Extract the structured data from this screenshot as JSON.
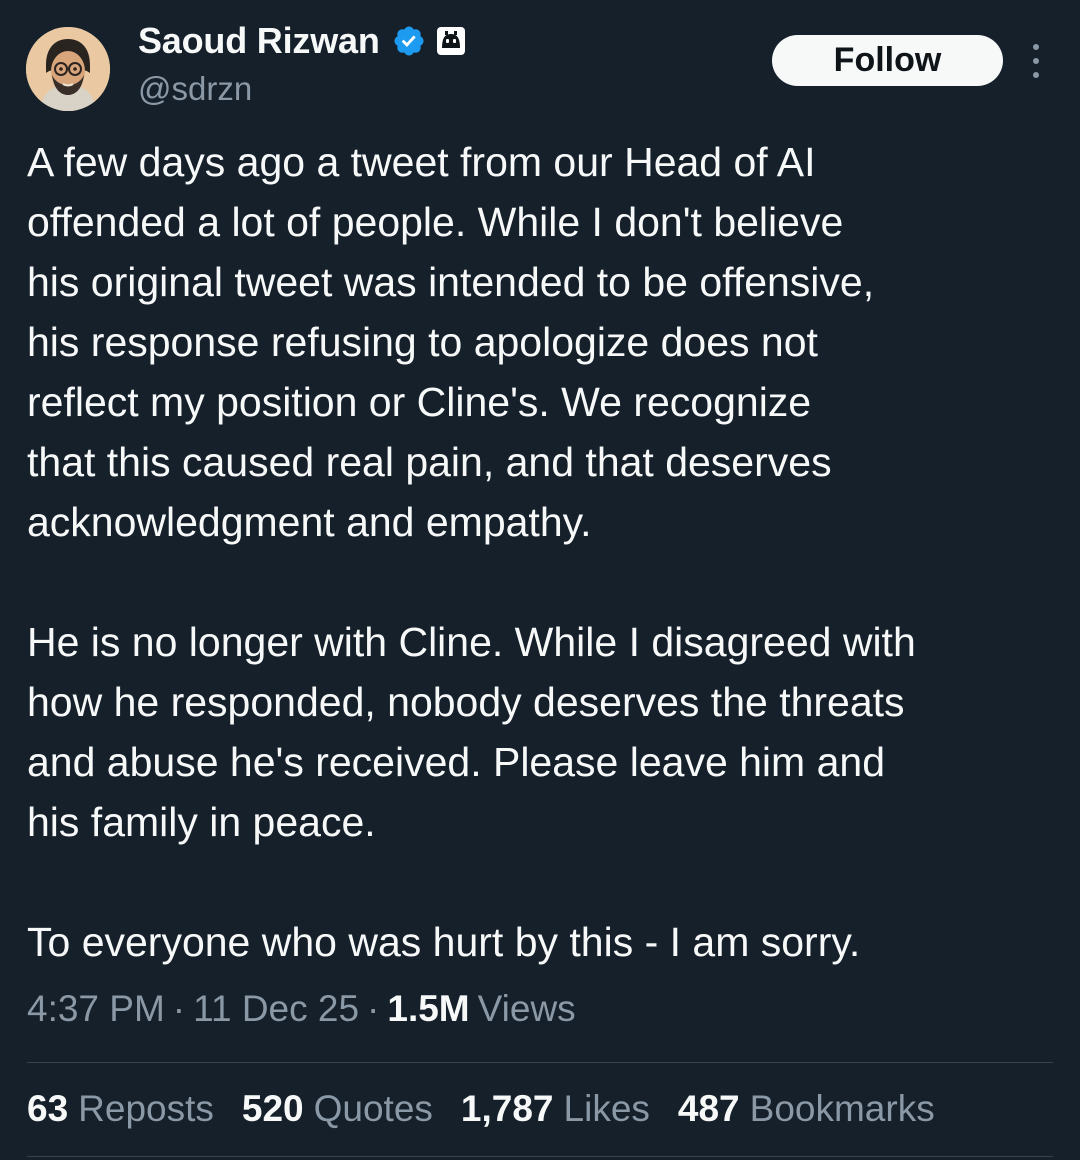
{
  "author": {
    "display_name": "Saoud Rizwan",
    "handle": "@sdrzn",
    "verified_badge_icon": "verified-checkmark-icon",
    "verified_color": "#1d9bf0",
    "bot_badge_icon": "bot-icon"
  },
  "header": {
    "follow_label": "Follow",
    "more_icon": "more-vertical-icon"
  },
  "tweet": {
    "paragraphs": [
      "A few days ago a tweet from our Head of AI\noffended a lot of people. While I don't believe\nhis original tweet was intended to be offensive,\nhis response refusing to apologize does not\nreflect my position or Cline's. We recognize\nthat this caused real pain, and that deserves\nacknowledgment and empathy.",
      "He is no longer with Cline. While I disagreed with\nhow he responded, nobody deserves the threats\nand abuse he's received. Please leave him and\nhis family in peace.",
      "To everyone who was hurt by this - I am sorry."
    ]
  },
  "meta": {
    "time": "4:37 PM",
    "separator": "·",
    "date": "11 Dec 25",
    "views_count": "1.5M",
    "views_label": "Views"
  },
  "stats": {
    "reposts": {
      "count": "63",
      "label": "Reposts"
    },
    "quotes": {
      "count": "520",
      "label": "Quotes"
    },
    "likes": {
      "count": "1,787",
      "label": "Likes"
    },
    "bookmarks": {
      "count": "487",
      "label": "Bookmarks"
    }
  },
  "colors": {
    "background": "#15202b",
    "text_primary": "#f7f9f9",
    "text_secondary": "#8b98a5",
    "divider": "#38444d"
  }
}
